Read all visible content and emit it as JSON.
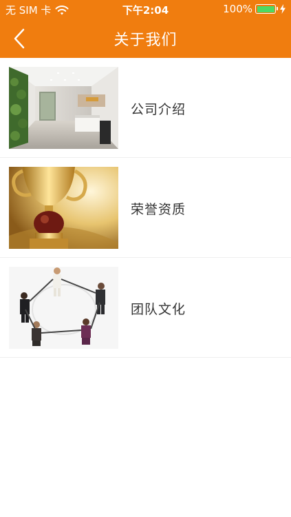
{
  "status_bar": {
    "carrier": "无 SIM 卡",
    "time": "下午2:04",
    "battery": "100%",
    "wifi_icon": "wifi-icon",
    "battery_icon": "battery-icon",
    "charging_icon": "bolt-icon"
  },
  "nav": {
    "title": "关于我们",
    "back_icon": "chevron-left-icon"
  },
  "items": [
    {
      "label": "公司介绍",
      "image": "office-lobby-photo"
    },
    {
      "label": "荣誉资质",
      "image": "trophy-photo"
    },
    {
      "label": "团队文化",
      "image": "team-circle-photo"
    }
  ],
  "colors": {
    "header": "#f07d0f",
    "text": "#333333",
    "divider": "#eeeeee",
    "battery_fill": "#4cd964"
  }
}
